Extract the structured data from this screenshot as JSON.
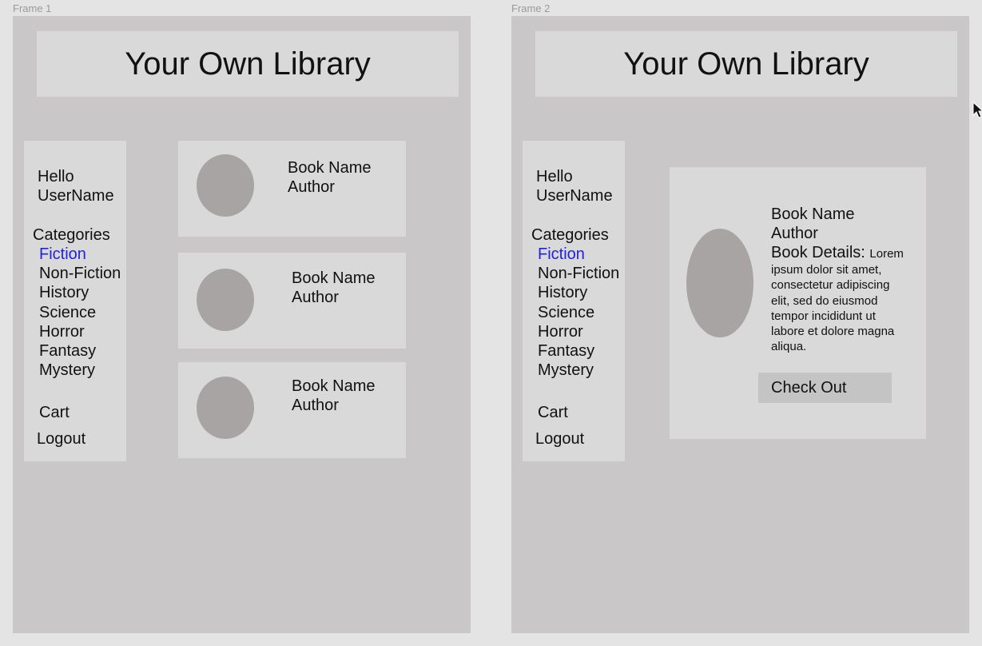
{
  "frames": [
    {
      "label": "Frame 1",
      "header_title": "Your Own Library",
      "sidebar": {
        "greeting": [
          "Hello",
          "UserName"
        ],
        "categories_title": "Categories",
        "categories": [
          "Fiction",
          "Non-Fiction",
          "History",
          "Science",
          "Horror",
          "Fantasy",
          "Mystery"
        ],
        "active_category": "Fiction",
        "cart": "Cart",
        "logout": "Logout"
      },
      "books": [
        {
          "name": "Book Name",
          "author": "Author"
        },
        {
          "name": "Book Name",
          "author": "Author"
        },
        {
          "name": "Book Name",
          "author": "Author"
        }
      ]
    },
    {
      "label": "Frame 2",
      "header_title": "Your Own Library",
      "sidebar": {
        "greeting": [
          "Hello",
          "UserName"
        ],
        "categories_title": "Categories",
        "categories": [
          "Fiction",
          "Non-Fiction",
          "History",
          "Science",
          "Horror",
          "Fantasy",
          "Mystery"
        ],
        "active_category": "Fiction",
        "cart": "Cart",
        "logout": "Logout"
      },
      "detail": {
        "name": "Book Name",
        "author": "Author",
        "details_label": "Book Details:",
        "description_lines": [
          "Lorem",
          "ipsum dolor sit amet,",
          "consectetur adipiscing",
          "elit, sed do eiusmod",
          "tempor incididunt ut",
          "labore et dolore magna",
          "aliqua."
        ],
        "checkout_label": "Check Out"
      }
    }
  ],
  "colors": {
    "canvas": "#e4e4e4",
    "frame": "#c9c7c8",
    "panel": "#d9d9d9",
    "placeholder": "#a8a4a4",
    "active_link": "#2222dd",
    "button": "#c4c4c4"
  },
  "icons": {
    "pointer": "cursor-arrow-icon"
  }
}
